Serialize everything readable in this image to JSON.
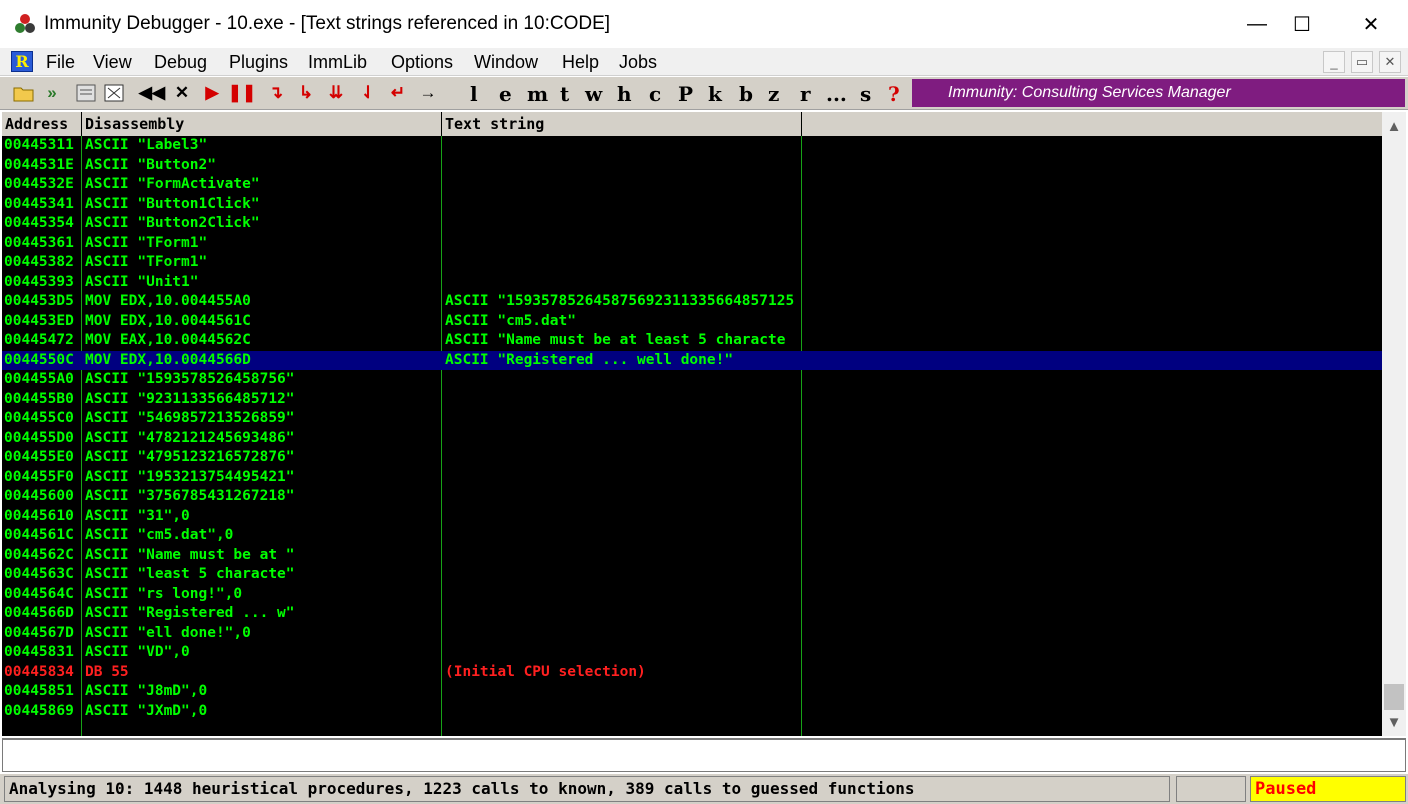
{
  "window": {
    "title": "Immunity Debugger - 10.exe - [Text strings referenced in 10:CODE]",
    "controls": {
      "minimize": "—",
      "maximize": "☐",
      "close": "✕"
    }
  },
  "menubar": {
    "logo": "R",
    "items": [
      "File",
      "View",
      "Debug",
      "Plugins",
      "ImmLib",
      "Options",
      "Window",
      "Help",
      "Jobs"
    ],
    "mdi_controls": [
      "_",
      "▭",
      "✕"
    ]
  },
  "toolbar": {
    "letters": [
      "l",
      "e",
      "m",
      "t",
      "w",
      "h",
      "c",
      "P",
      "k",
      "b",
      "z",
      "r",
      "...",
      "s",
      "?"
    ],
    "banner": "Immunity: Consulting Services Manager"
  },
  "columns": {
    "address": "Address",
    "disassembly": "Disassembly",
    "text_string": "Text string"
  },
  "colors": {
    "text_green": "#00ff00",
    "highlight_red": "#ff2020",
    "selection_blue": "#000080",
    "banner_purple": "#7f1c80",
    "paused_bg": "#ffff00",
    "paused_fg": "#ff0000"
  },
  "rows": [
    {
      "address": "00445311",
      "disassembly": "ASCII \"Label3\"",
      "text": "",
      "selected": false,
      "color": "green"
    },
    {
      "address": "0044531E",
      "disassembly": "ASCII \"Button2\"",
      "text": "",
      "selected": false,
      "color": "green"
    },
    {
      "address": "0044532E",
      "disassembly": "ASCII \"FormActivate\"",
      "text": "",
      "selected": false,
      "color": "green"
    },
    {
      "address": "00445341",
      "disassembly": "ASCII \"Button1Click\"",
      "text": "",
      "selected": false,
      "color": "green"
    },
    {
      "address": "00445354",
      "disassembly": "ASCII \"Button2Click\"",
      "text": "",
      "selected": false,
      "color": "green"
    },
    {
      "address": "00445361",
      "disassembly": "ASCII \"TForm1\"",
      "text": "",
      "selected": false,
      "color": "green"
    },
    {
      "address": "00445382",
      "disassembly": "ASCII \"TForm1\"",
      "text": "",
      "selected": false,
      "color": "green"
    },
    {
      "address": "00445393",
      "disassembly": "ASCII \"Unit1\"",
      "text": "",
      "selected": false,
      "color": "green"
    },
    {
      "address": "004453D5",
      "disassembly": "MOV EDX,10.004455A0",
      "text": "ASCII \"159357852645875692311335664857125",
      "selected": false,
      "color": "green"
    },
    {
      "address": "004453ED",
      "disassembly": "MOV EDX,10.0044561C",
      "text": "ASCII \"cm5.dat\"",
      "selected": false,
      "color": "green"
    },
    {
      "address": "00445472",
      "disassembly": "MOV EAX,10.0044562C",
      "text": "ASCII \"Name must be at least 5 characte",
      "selected": false,
      "color": "green"
    },
    {
      "address": "0044550C",
      "disassembly": "MOV EDX,10.0044566D",
      "text": "ASCII \"Registered ... well done!\"",
      "selected": true,
      "color": "green"
    },
    {
      "address": "004455A0",
      "disassembly": "ASCII \"1593578526458756\"",
      "text": "",
      "selected": false,
      "color": "green"
    },
    {
      "address": "004455B0",
      "disassembly": "ASCII \"9231133566485712\"",
      "text": "",
      "selected": false,
      "color": "green"
    },
    {
      "address": "004455C0",
      "disassembly": "ASCII \"5469857213526859\"",
      "text": "",
      "selected": false,
      "color": "green"
    },
    {
      "address": "004455D0",
      "disassembly": "ASCII \"4782121245693486\"",
      "text": "",
      "selected": false,
      "color": "green"
    },
    {
      "address": "004455E0",
      "disassembly": "ASCII \"4795123216572876\"",
      "text": "",
      "selected": false,
      "color": "green"
    },
    {
      "address": "004455F0",
      "disassembly": "ASCII \"1953213754495421\"",
      "text": "",
      "selected": false,
      "color": "green"
    },
    {
      "address": "00445600",
      "disassembly": "ASCII \"3756785431267218\"",
      "text": "",
      "selected": false,
      "color": "green"
    },
    {
      "address": "00445610",
      "disassembly": "ASCII \"31\",0",
      "text": "",
      "selected": false,
      "color": "green"
    },
    {
      "address": "0044561C",
      "disassembly": "ASCII \"cm5.dat\",0",
      "text": "",
      "selected": false,
      "color": "green"
    },
    {
      "address": "0044562C",
      "disassembly": "ASCII \"Name must be at \"",
      "text": "",
      "selected": false,
      "color": "green"
    },
    {
      "address": "0044563C",
      "disassembly": "ASCII \"least 5 characte\"",
      "text": "",
      "selected": false,
      "color": "green"
    },
    {
      "address": "0044564C",
      "disassembly": "ASCII \"rs long!\",0",
      "text": "",
      "selected": false,
      "color": "green"
    },
    {
      "address": "0044566D",
      "disassembly": "ASCII \"Registered ... w\"",
      "text": "",
      "selected": false,
      "color": "green"
    },
    {
      "address": "0044567D",
      "disassembly": "ASCII \"ell done!\",0",
      "text": "",
      "selected": false,
      "color": "green"
    },
    {
      "address": "00445831",
      "disassembly": "ASCII \"VD\",0",
      "text": "",
      "selected": false,
      "color": "green"
    },
    {
      "address": "00445834",
      "disassembly": "DB 55",
      "text": "(Initial CPU selection)",
      "selected": false,
      "color": "red"
    },
    {
      "address": "00445851",
      "disassembly": "ASCII \"J8mD\",0",
      "text": "",
      "selected": false,
      "color": "green"
    },
    {
      "address": "00445869",
      "disassembly": "ASCII \"JXmD\",0",
      "text": "",
      "selected": false,
      "color": "green"
    }
  ],
  "command_line": {
    "value": ""
  },
  "status": {
    "message": "Analysing 10: 1448 heuristical procedures, 1223 calls to known, 389 calls to guessed functions",
    "state": "Paused"
  }
}
